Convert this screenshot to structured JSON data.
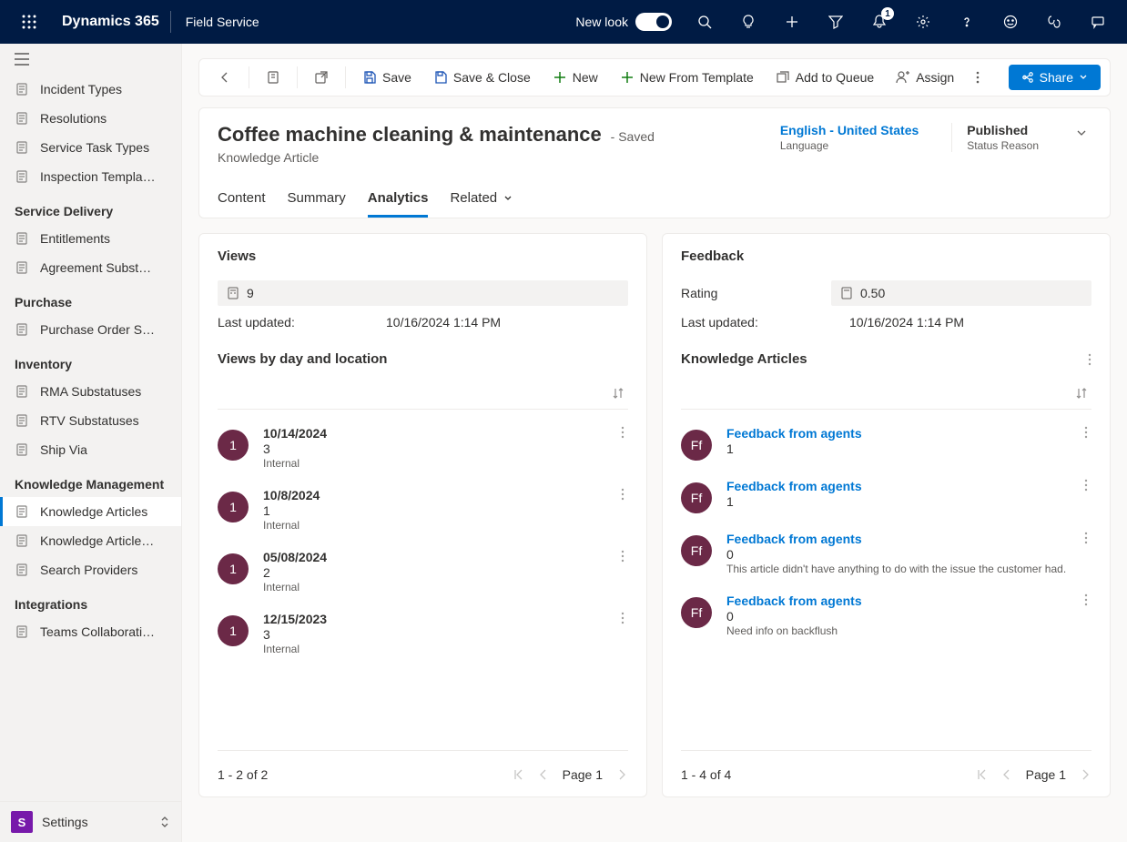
{
  "topbar": {
    "brand": "Dynamics 365",
    "app": "Field Service",
    "newlook": "New look",
    "notif_badge": "1"
  },
  "sidebar": {
    "groups": [
      {
        "title": null,
        "items": [
          {
            "label": "Incident Types",
            "name": "incident-types"
          },
          {
            "label": "Resolutions",
            "name": "resolutions"
          },
          {
            "label": "Service Task Types",
            "name": "service-task-types"
          },
          {
            "label": "Inspection Templa…",
            "name": "inspection-templates"
          }
        ]
      },
      {
        "title": "Service Delivery",
        "items": [
          {
            "label": "Entitlements",
            "name": "entitlements"
          },
          {
            "label": "Agreement Subst…",
            "name": "agreement-subst"
          }
        ]
      },
      {
        "title": "Purchase",
        "items": [
          {
            "label": "Purchase Order S…",
            "name": "purchase-order-s"
          }
        ]
      },
      {
        "title": "Inventory",
        "items": [
          {
            "label": "RMA Substatuses",
            "name": "rma-substatuses"
          },
          {
            "label": "RTV Substatuses",
            "name": "rtv-substatuses"
          },
          {
            "label": "Ship Via",
            "name": "ship-via"
          }
        ]
      },
      {
        "title": "Knowledge Management",
        "items": [
          {
            "label": "Knowledge Articles",
            "name": "knowledge-articles",
            "active": true
          },
          {
            "label": "Knowledge Article…",
            "name": "knowledge-article-t"
          },
          {
            "label": "Search Providers",
            "name": "search-providers"
          }
        ]
      },
      {
        "title": "Integrations",
        "items": [
          {
            "label": "Teams Collaborati…",
            "name": "teams-collab"
          }
        ]
      }
    ],
    "area": {
      "letter": "S",
      "label": "Settings"
    }
  },
  "commands": {
    "save": "Save",
    "save_close": "Save & Close",
    "new": "New",
    "new_template": "New From Template",
    "add_queue": "Add to Queue",
    "assign": "Assign",
    "share": "Share"
  },
  "record": {
    "title": "Coffee machine cleaning & maintenance",
    "saved": "- Saved",
    "entity": "Knowledge Article",
    "language": {
      "value": "English - United States",
      "label": "Language"
    },
    "status": {
      "value": "Published",
      "label": "Status Reason"
    },
    "tabs": [
      "Content",
      "Summary",
      "Analytics",
      "Related"
    ],
    "active_tab": "Analytics"
  },
  "views": {
    "title": "Views",
    "count": "9",
    "updated_label": "Last updated:",
    "updated_value": "10/16/2024 1:14 PM",
    "sub_title": "Views by day and location",
    "items": [
      {
        "badge": "1",
        "date": "10/14/2024",
        "count": "3",
        "source": "Internal"
      },
      {
        "badge": "1",
        "date": "10/8/2024",
        "count": "1",
        "source": "Internal"
      },
      {
        "badge": "1",
        "date": "05/08/2024",
        "count": "2",
        "source": "Internal"
      },
      {
        "badge": "1",
        "date": "12/15/2023",
        "count": "3",
        "source": "Internal"
      }
    ],
    "pager": {
      "range": "1 - 2 of 2",
      "page": "Page 1"
    }
  },
  "feedback": {
    "title": "Feedback",
    "rating_label": "Rating",
    "rating_value": "0.50",
    "updated_label": "Last updated:",
    "updated_value": "10/16/2024 1:14 PM",
    "sub_title": "Knowledge Articles",
    "items": [
      {
        "avatar": "Ff",
        "title": "Feedback from agents",
        "score": "1",
        "comment": ""
      },
      {
        "avatar": "Ff",
        "title": "Feedback from agents",
        "score": "1",
        "comment": ""
      },
      {
        "avatar": "Ff",
        "title": "Feedback from agents",
        "score": "0",
        "comment": "This article didn't have anything to do with the issue the customer had."
      },
      {
        "avatar": "Ff",
        "title": "Feedback from agents",
        "score": "0",
        "comment": "Need info on backflush"
      }
    ],
    "pager": {
      "range": "1 - 4 of 4",
      "page": "Page 1"
    }
  }
}
